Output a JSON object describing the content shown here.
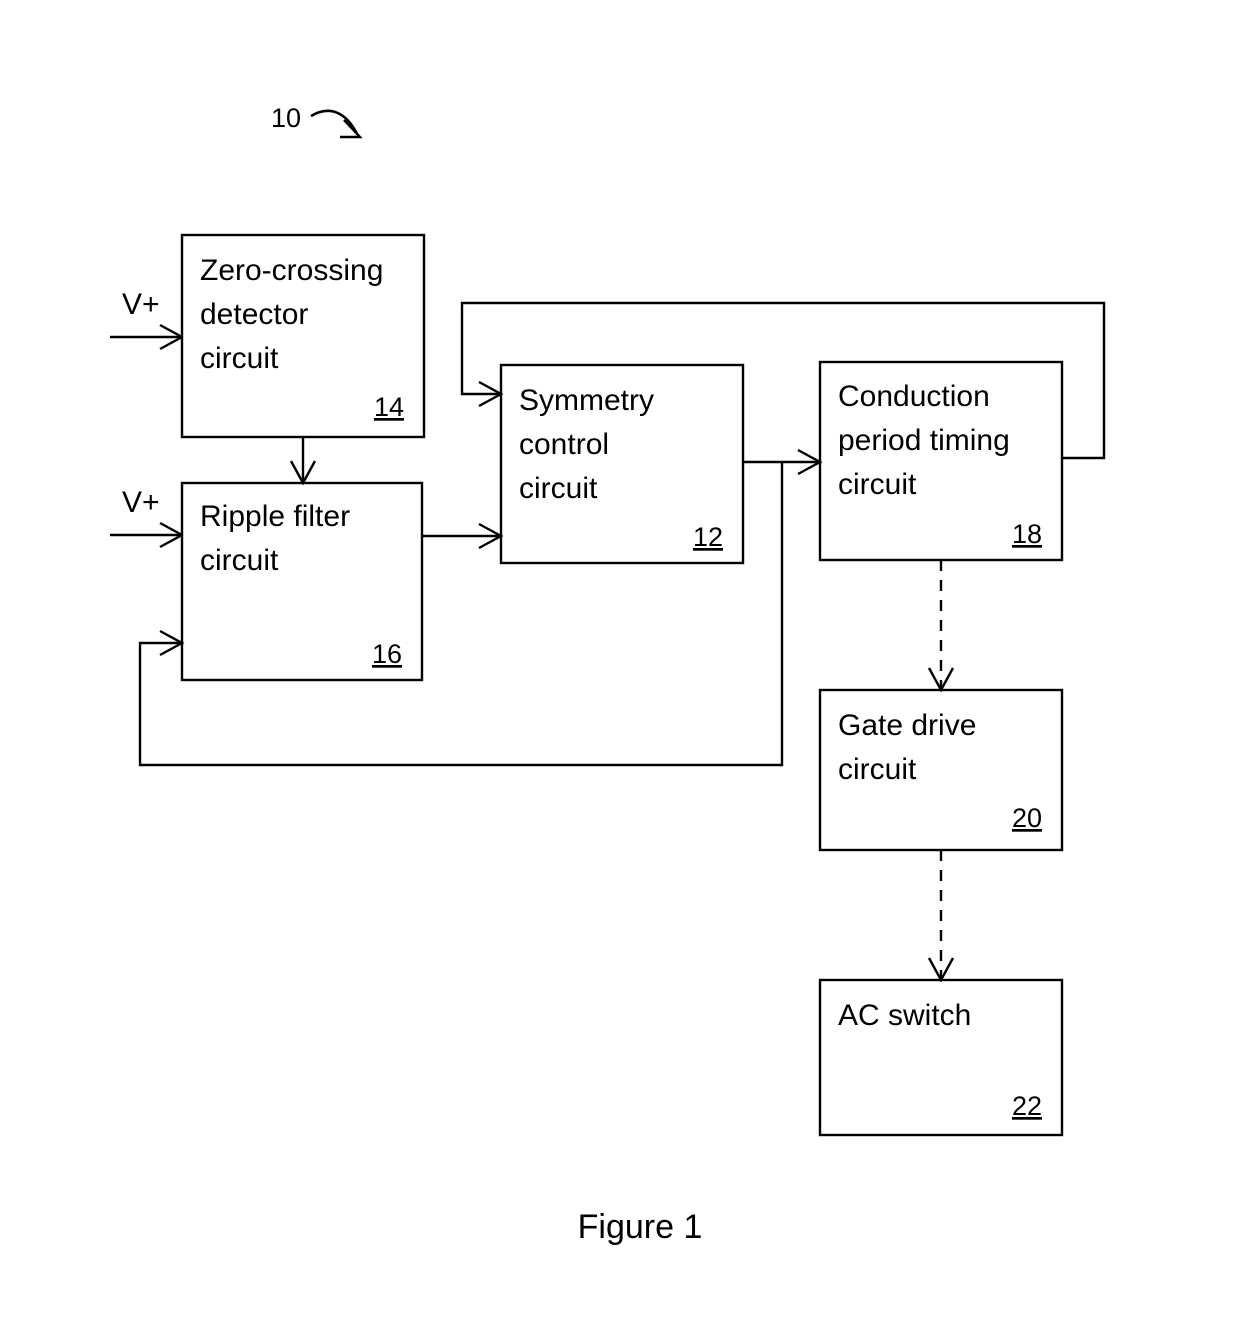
{
  "figure": {
    "caption": "Figure 1",
    "lead_number": "10"
  },
  "ports": {
    "vplus_top": "V+",
    "vplus_bottom": "V+"
  },
  "blocks": [
    {
      "id": "zero-crossing-detector",
      "lines": [
        "Zero-crossing",
        "detector",
        "circuit"
      ],
      "line1": "Zero-crossing",
      "line2": "detector",
      "line3": "circuit",
      "ref": "14"
    },
    {
      "id": "ripple-filter",
      "lines": [
        "Ripple filter",
        "circuit"
      ],
      "line1": "Ripple filter",
      "line2": "circuit",
      "ref": "16"
    },
    {
      "id": "symmetry-control",
      "lines": [
        "Symmetry",
        "control",
        "circuit"
      ],
      "line1": "Symmetry",
      "line2": "control",
      "line3": "circuit",
      "ref": "12"
    },
    {
      "id": "conduction-period-timing",
      "lines": [
        "Conduction",
        "period timing",
        "circuit"
      ],
      "line1": "Conduction",
      "line2": "period timing",
      "line3": "circuit",
      "ref": "18"
    },
    {
      "id": "gate-drive",
      "lines": [
        "Gate drive",
        "circuit"
      ],
      "line1": "Gate drive",
      "line2": "circuit",
      "ref": "20"
    },
    {
      "id": "ac-switch",
      "lines": [
        "AC switch"
      ],
      "line1": "AC switch",
      "ref": "22"
    }
  ],
  "colors": {
    "stroke": "#000000",
    "background": "#ffffff",
    "text": "#000000"
  }
}
